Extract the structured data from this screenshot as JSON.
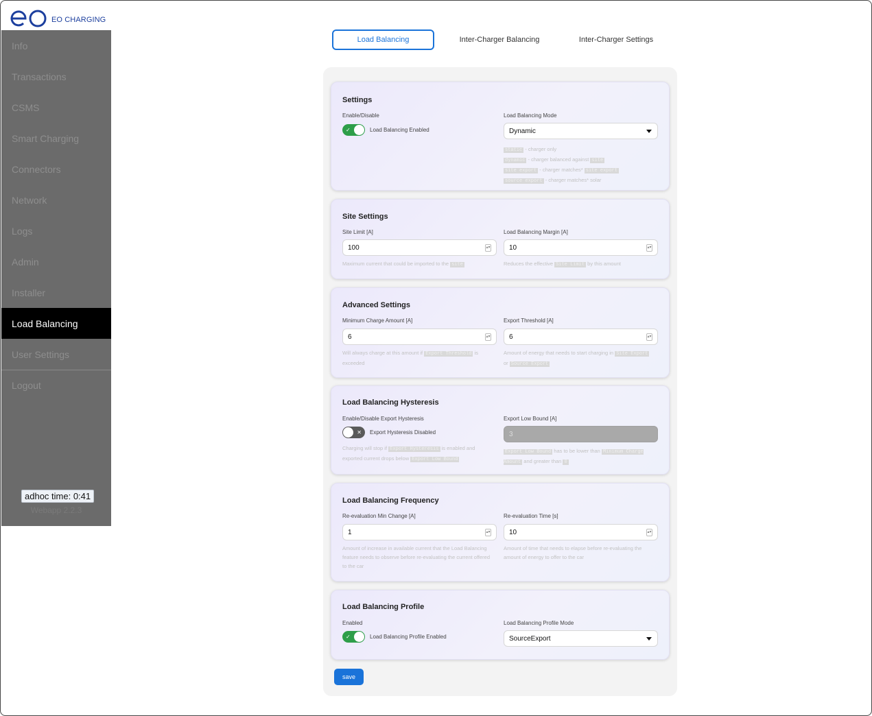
{
  "brand": {
    "name": "EO CHARGING",
    "logo_color": "#1c3f9e"
  },
  "sidebar": {
    "items": [
      {
        "label": "Info"
      },
      {
        "label": "Transactions"
      },
      {
        "label": "CSMS"
      },
      {
        "label": "Smart Charging"
      },
      {
        "label": "Connectors"
      },
      {
        "label": "Network"
      },
      {
        "label": "Logs"
      },
      {
        "label": "Admin"
      },
      {
        "label": "Installer"
      },
      {
        "label": "Load Balancing",
        "active": true
      },
      {
        "label": "User Settings"
      },
      {
        "label": "Logout"
      }
    ],
    "adhoc_time": "adhoc time: 0:41",
    "webapp_version": "Webapp 2.2.3"
  },
  "tabs": [
    {
      "label": "Load Balancing",
      "active": true
    },
    {
      "label": "Inter-Charger Balancing"
    },
    {
      "label": "Inter-Charger Settings"
    }
  ],
  "settings": {
    "title": "Settings",
    "enable_label": "Enable/Disable",
    "toggle_text": "Load Balancing Enabled",
    "toggle_on": true,
    "mode_label": "Load Balancing Mode",
    "mode_value": "Dynamic",
    "mode_help": [
      {
        "code": "static",
        "text": " - charger only",
        "code2": ""
      },
      {
        "code": "dynamic",
        "text": " - charger balanced against ",
        "code2": "site"
      },
      {
        "code": "site export",
        "text": " - charger matches* ",
        "code2": "site export"
      },
      {
        "code": "source export",
        "text": " - charger matches* solar",
        "code2": ""
      }
    ]
  },
  "site_settings": {
    "title": "Site Settings",
    "limit_label": "Site Limit [A]",
    "limit_value": "100",
    "limit_help_pre": "Maximum current that could be imported to the ",
    "limit_help_code": "site",
    "margin_label": "Load Balancing Margin [A]",
    "margin_value": "10",
    "margin_help_pre": "Reduces the effective ",
    "margin_help_code": "Site Limit",
    "margin_help_post": " by this amount"
  },
  "advanced": {
    "title": "Advanced Settings",
    "min_label": "Minimum Charge Amount [A]",
    "min_value": "6",
    "min_help_pre": "Will always charge at this amount if ",
    "min_help_code": "Export Threshold",
    "min_help_post": " is exceeded",
    "export_label": "Export Threshold [A]",
    "export_value": "6",
    "export_help_pre": "Amount of energy that needs to start charging in ",
    "export_help_code1": "Site Export",
    "export_help_mid": " or ",
    "export_help_code2": "Source Export"
  },
  "hysteresis": {
    "title": "Load Balancing Hysteresis",
    "enable_label": "Enable/Disable Export Hysteresis",
    "toggle_text": "Export Hysteresis Disabled",
    "toggle_on": false,
    "help_pre": "Charging will stop if ",
    "help_code1": "Export Hysteresis",
    "help_mid": " is enabled and exported current drops below ",
    "help_code2": "Export Low Bound",
    "low_label": "Export Low Bound [A]",
    "low_value": "3",
    "low_help_code1": "Export Low Bound",
    "low_help_mid": " has to be lower than ",
    "low_help_code2": "Minimum Charge Amount",
    "low_help_mid2": " and greater than ",
    "low_help_code3": "0"
  },
  "frequency": {
    "title": "Load Balancing Frequency",
    "change_label": "Re-evaluation Min Change [A]",
    "change_value": "1",
    "change_help": "Amount of increase in available current that the Load Balancing feature needs to observe before re-evaluating the current offered to the car",
    "time_label": "Re-evaluation Time [s]",
    "time_value": "10",
    "time_help": "Amount of time that needs to elapse before re-evaluating the amount of energy to offer to the car"
  },
  "profile": {
    "title": "Load Balancing Profile",
    "enable_label": "Enabled",
    "toggle_text": "Load Balancing Profile Enabled",
    "toggle_on": true,
    "mode_label": "Load Balancing Profile Mode",
    "mode_value": "SourceExport"
  },
  "save_label": "save",
  "colors": {
    "accent": "#1a73d9",
    "toggle_on": "#2e9e49",
    "sidebar_bg": "#6b6b6b"
  }
}
